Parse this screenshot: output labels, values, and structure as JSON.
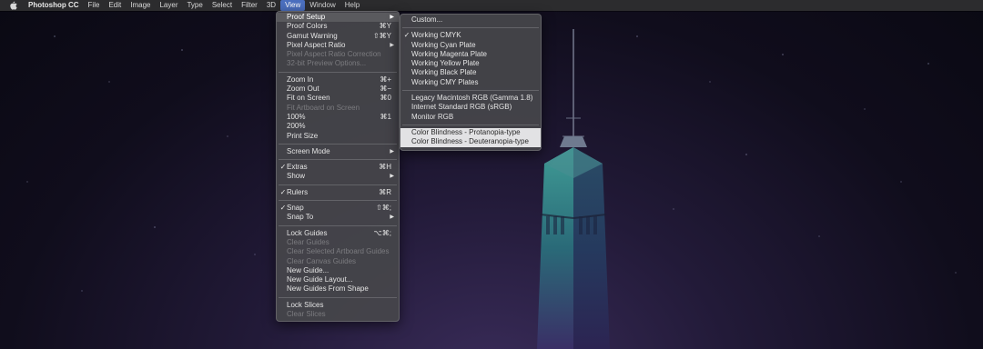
{
  "menubar": {
    "apple_icon": "apple-icon",
    "items": [
      {
        "label": "Photoshop CC"
      },
      {
        "label": "File"
      },
      {
        "label": "Edit"
      },
      {
        "label": "Image"
      },
      {
        "label": "Layer"
      },
      {
        "label": "Type"
      },
      {
        "label": "Select"
      },
      {
        "label": "Filter"
      },
      {
        "label": "3D"
      },
      {
        "label": "View"
      },
      {
        "label": "Window"
      },
      {
        "label": "Help"
      }
    ],
    "active_item": "View"
  },
  "view_menu": {
    "proof_setup": {
      "label": "Proof Setup"
    },
    "proof_colors": {
      "label": "Proof Colors",
      "shortcut": "⌘Y"
    },
    "gamut_warning": {
      "label": "Gamut Warning",
      "shortcut": "⇧⌘Y"
    },
    "pixel_aspect_ratio": {
      "label": "Pixel Aspect Ratio"
    },
    "pixel_aspect_ratio_correction": {
      "label": "Pixel Aspect Ratio Correction"
    },
    "preview_options": {
      "label": "32-bit Preview Options..."
    },
    "zoom_in": {
      "label": "Zoom In",
      "shortcut": "⌘+"
    },
    "zoom_out": {
      "label": "Zoom Out",
      "shortcut": "⌘−"
    },
    "fit_on_screen": {
      "label": "Fit on Screen",
      "shortcut": "⌘0"
    },
    "fit_artboard": {
      "label": "Fit Artboard on Screen"
    },
    "zoom_100": {
      "label": "100%",
      "shortcut": "⌘1"
    },
    "zoom_200": {
      "label": "200%"
    },
    "print_size": {
      "label": "Print Size"
    },
    "screen_mode": {
      "label": "Screen Mode"
    },
    "extras": {
      "label": "Extras",
      "shortcut": "⌘H",
      "checked": true
    },
    "show": {
      "label": "Show"
    },
    "rulers": {
      "label": "Rulers",
      "shortcut": "⌘R",
      "checked": true
    },
    "snap": {
      "label": "Snap",
      "shortcut": "⇧⌘;",
      "checked": true
    },
    "snap_to": {
      "label": "Snap To"
    },
    "lock_guides": {
      "label": "Lock Guides",
      "shortcut": "⌥⌘;"
    },
    "clear_guides": {
      "label": "Clear Guides"
    },
    "clear_artboard_guides": {
      "label": "Clear Selected Artboard Guides"
    },
    "clear_canvas_guides": {
      "label": "Clear Canvas Guides"
    },
    "new_guide": {
      "label": "New Guide..."
    },
    "new_guide_layout": {
      "label": "New Guide Layout..."
    },
    "new_guides_from_shape": {
      "label": "New Guides From Shape"
    },
    "lock_slices": {
      "label": "Lock Slices"
    },
    "clear_slices": {
      "label": "Clear Slices"
    }
  },
  "proof_submenu": {
    "custom": {
      "label": "Custom..."
    },
    "working_cmyk": {
      "label": "Working CMYK",
      "checked": true
    },
    "working_cyan": {
      "label": "Working Cyan Plate"
    },
    "working_magenta": {
      "label": "Working Magenta Plate"
    },
    "working_yellow": {
      "label": "Working Yellow Plate"
    },
    "working_black": {
      "label": "Working Black Plate"
    },
    "working_cmy": {
      "label": "Working CMY Plates"
    },
    "legacy_mac_rgb": {
      "label": "Legacy Macintosh RGB (Gamma 1.8)"
    },
    "internet_srgb": {
      "label": "Internet Standard RGB (sRGB)"
    },
    "monitor_rgb": {
      "label": "Monitor RGB"
    },
    "protanopia": {
      "label": "Color Blindness - Protanopia-type"
    },
    "deuteranopia": {
      "label": "Color Blindness - Deuteranopia-type"
    }
  },
  "check_mark": "✓",
  "submenu_arrow": "▶",
  "colors": {
    "menubar_bg": "#2c2c2e",
    "menu_bg": "#46464a",
    "active_menu_title": "#4b6fbf",
    "highlight_light": "#e2e2e4"
  }
}
